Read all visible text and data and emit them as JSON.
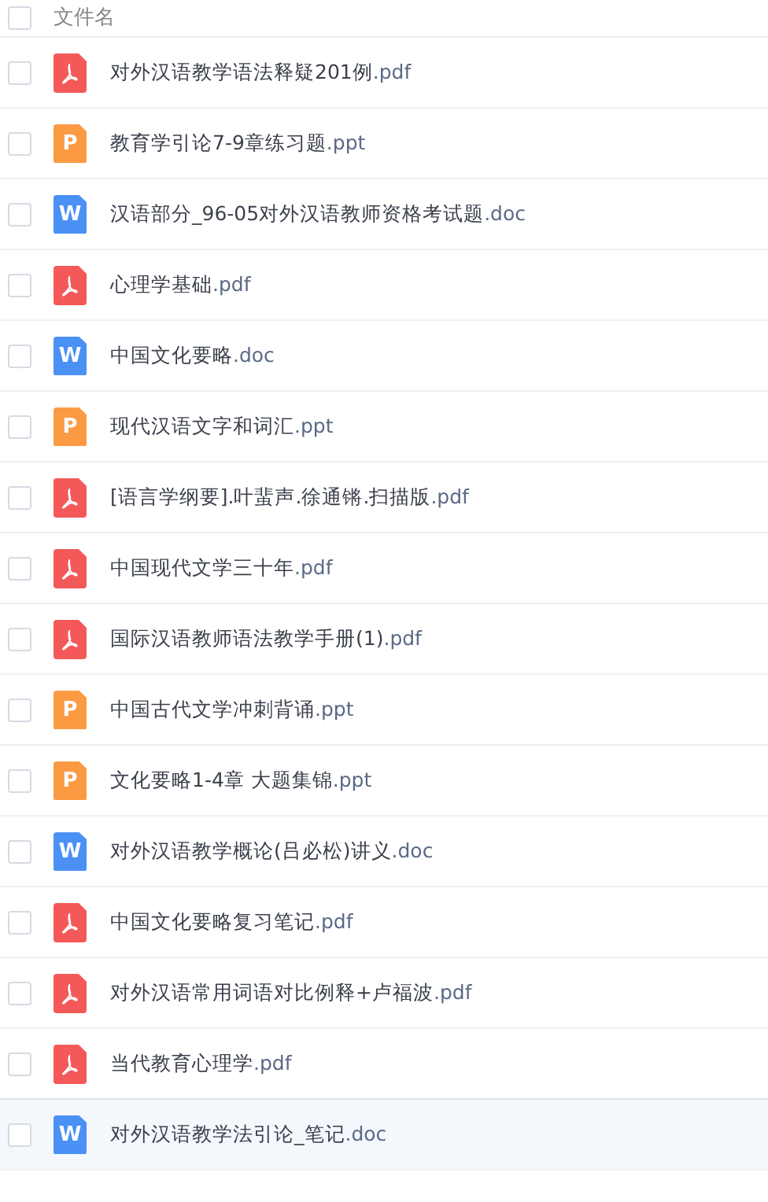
{
  "table": {
    "header": {
      "label": "文件名",
      "checked": false
    },
    "rows": [
      {
        "kind": "pdf",
        "file_name": "对外汉语教学语法释疑201例.pdf",
        "checked": false,
        "selected": false
      },
      {
        "kind": "ppt",
        "badge": "P",
        "file_name": "教育学引论7-9章练习题.ppt",
        "checked": false,
        "selected": false
      },
      {
        "kind": "doc",
        "badge": "W",
        "file_name": "汉语部分_96-05对外汉语教师资格考试题.doc",
        "checked": false,
        "selected": false
      },
      {
        "kind": "pdf",
        "file_name": "心理学基础.pdf",
        "checked": false,
        "selected": false
      },
      {
        "kind": "doc",
        "badge": "W",
        "file_name": "中国文化要略.doc",
        "checked": false,
        "selected": false
      },
      {
        "kind": "ppt",
        "badge": "P",
        "file_name": "现代汉语文字和词汇.ppt",
        "checked": false,
        "selected": false
      },
      {
        "kind": "pdf",
        "file_name": "[语言学纲要].叶蜚声.徐通锵.扫描版.pdf",
        "checked": false,
        "selected": false
      },
      {
        "kind": "pdf",
        "file_name": "中国现代文学三十年.pdf",
        "checked": false,
        "selected": false
      },
      {
        "kind": "pdf",
        "file_name": "国际汉语教师语法教学手册(1).pdf",
        "checked": false,
        "selected": false
      },
      {
        "kind": "ppt",
        "badge": "P",
        "file_name": "中国古代文学冲刺背诵.ppt",
        "checked": false,
        "selected": false
      },
      {
        "kind": "ppt",
        "badge": "P",
        "file_name": "文化要略1-4章 大题集锦.ppt",
        "checked": false,
        "selected": false
      },
      {
        "kind": "doc",
        "badge": "W",
        "file_name": "对外汉语教学概论(吕必松)讲义.doc",
        "checked": false,
        "selected": false
      },
      {
        "kind": "pdf",
        "file_name": "中国文化要略复习笔记.pdf",
        "checked": false,
        "selected": false
      },
      {
        "kind": "pdf",
        "file_name": "对外汉语常用词语对比例释+卢福波.pdf",
        "checked": false,
        "selected": false
      },
      {
        "kind": "pdf",
        "file_name": "当代教育心理学.pdf",
        "checked": false,
        "selected": false
      },
      {
        "kind": "doc",
        "badge": "W",
        "file_name": "对外汉语教学法引论_笔记.doc",
        "checked": false,
        "selected": true
      }
    ]
  }
}
